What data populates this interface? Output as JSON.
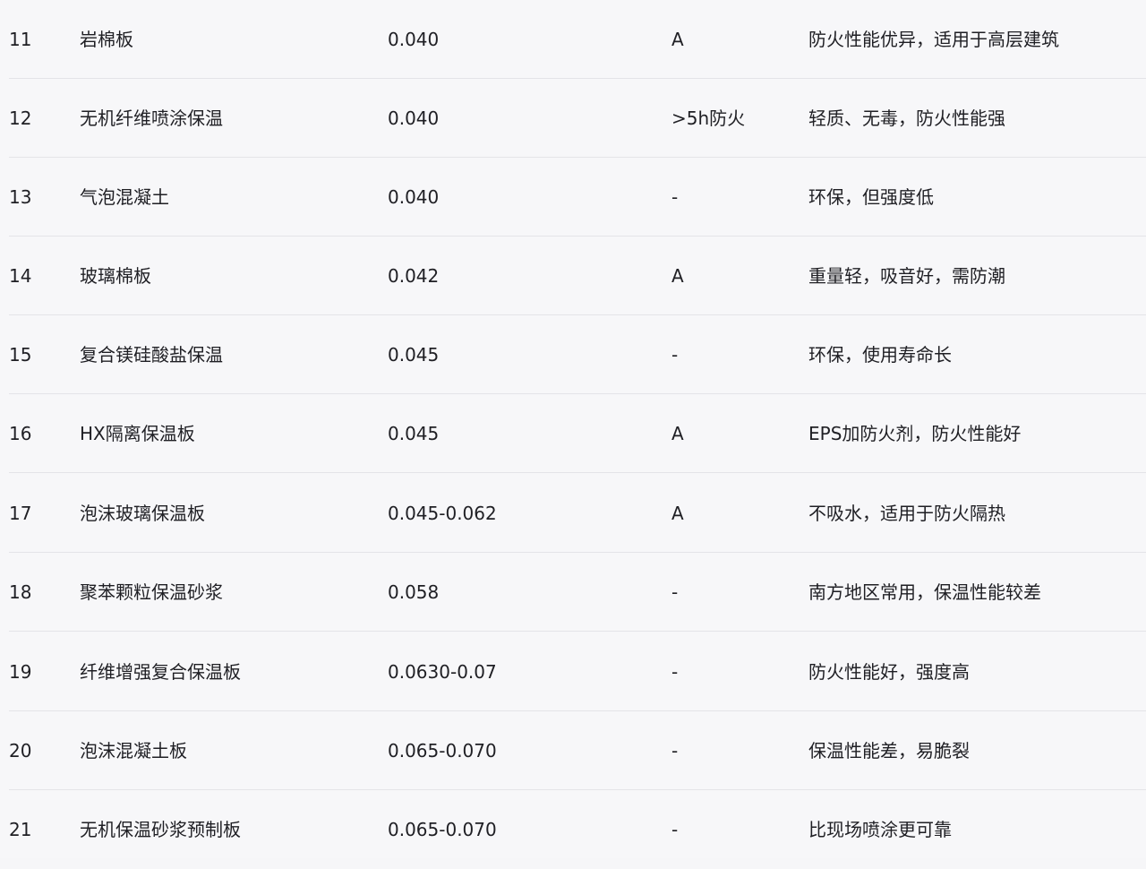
{
  "rows": [
    {
      "idx": "11",
      "name": "岩棉板",
      "value": "0.040",
      "grade": "A",
      "note": "防火性能优异，适用于高层建筑"
    },
    {
      "idx": "12",
      "name": "无机纤维喷涂保温",
      "value": "0.040",
      "grade": ">5h防火",
      "note": "轻质、无毒，防火性能强"
    },
    {
      "idx": "13",
      "name": "气泡混凝土",
      "value": "0.040",
      "grade": "-",
      "note": "环保，但强度低"
    },
    {
      "idx": "14",
      "name": "玻璃棉板",
      "value": "0.042",
      "grade": "A",
      "note": "重量轻，吸音好，需防潮"
    },
    {
      "idx": "15",
      "name": "复合镁硅酸盐保温",
      "value": "0.045",
      "grade": "-",
      "note": "环保，使用寿命长"
    },
    {
      "idx": "16",
      "name": "HX隔离保温板",
      "value": "0.045",
      "grade": "A",
      "note": "EPS加防火剂，防火性能好"
    },
    {
      "idx": "17",
      "name": "泡沫玻璃保温板",
      "value": "0.045-0.062",
      "grade": "A",
      "note": "不吸水，适用于防火隔热"
    },
    {
      "idx": "18",
      "name": "聚苯颗粒保温砂浆",
      "value": "0.058",
      "grade": "-",
      "note": "南方地区常用，保温性能较差"
    },
    {
      "idx": "19",
      "name": "纤维增强复合保温板",
      "value": "0.0630-0.07",
      "grade": "-",
      "note": "防火性能好，强度高"
    },
    {
      "idx": "20",
      "name": "泡沫混凝土板",
      "value": "0.065-0.070",
      "grade": "-",
      "note": "保温性能差，易脆裂"
    },
    {
      "idx": "21",
      "name": "无机保温砂浆预制板",
      "value": "0.065-0.070",
      "grade": "-",
      "note": "比现场喷涂更可靠"
    }
  ]
}
